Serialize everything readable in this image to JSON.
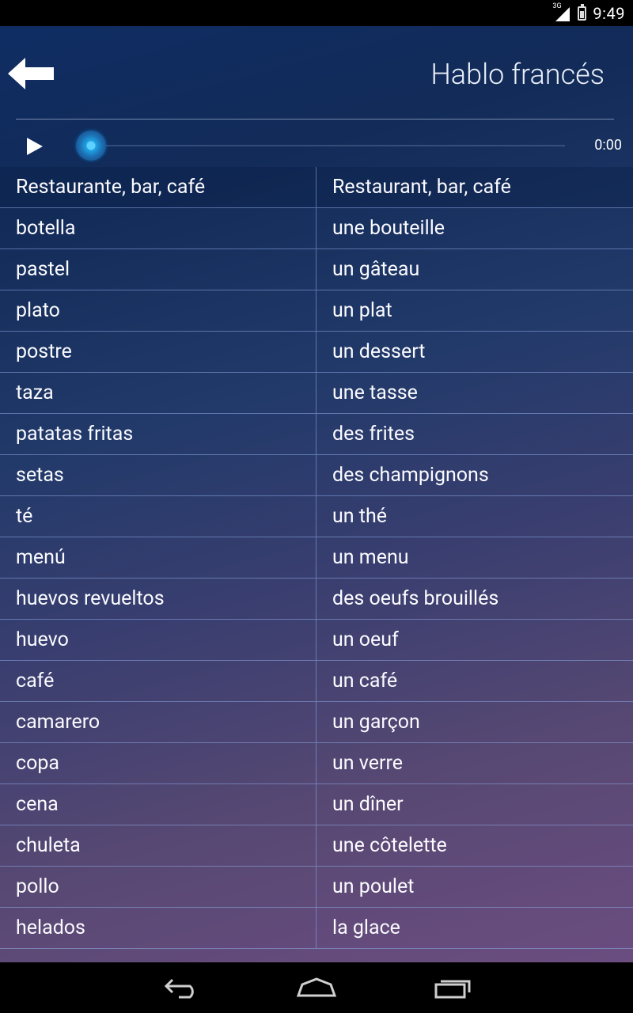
{
  "status_bar": {
    "network": "3G",
    "clock": "9:49"
  },
  "header": {
    "title": "Hablo francés"
  },
  "player": {
    "time": "0:00"
  },
  "vocabulary": [
    {
      "es": "Restaurante, bar, café",
      "fr": "Restaurant, bar, café"
    },
    {
      "es": "botella",
      "fr": "une bouteille"
    },
    {
      "es": "pastel",
      "fr": "un gâteau"
    },
    {
      "es": "plato",
      "fr": "un plat"
    },
    {
      "es": "postre",
      "fr": "un dessert"
    },
    {
      "es": "taza",
      "fr": "une tasse"
    },
    {
      "es": "patatas fritas",
      "fr": "des frites"
    },
    {
      "es": "setas",
      "fr": "des champignons"
    },
    {
      "es": "té",
      "fr": "un thé"
    },
    {
      "es": "menú",
      "fr": "un menu"
    },
    {
      "es": "huevos revueltos",
      "fr": "des oeufs brouillés"
    },
    {
      "es": "huevo",
      "fr": "un oeuf"
    },
    {
      "es": "café",
      "fr": "un café"
    },
    {
      "es": "camarero",
      "fr": "un garçon"
    },
    {
      "es": "copa",
      "fr": "un verre"
    },
    {
      "es": "cena",
      "fr": "un dîner"
    },
    {
      "es": "chuleta",
      "fr": "une côtelette"
    },
    {
      "es": "pollo",
      "fr": "un poulet"
    },
    {
      "es": "helados",
      "fr": "la glace"
    }
  ],
  "icons": {
    "back": "arrow-left-icon",
    "play": "play-icon",
    "nav_back": "nav-back-icon",
    "nav_home": "nav-home-icon",
    "nav_recents": "nav-recents-icon"
  },
  "colors": {
    "seek_accent": "#1ea4e4",
    "grid_line": "#8caae6"
  }
}
